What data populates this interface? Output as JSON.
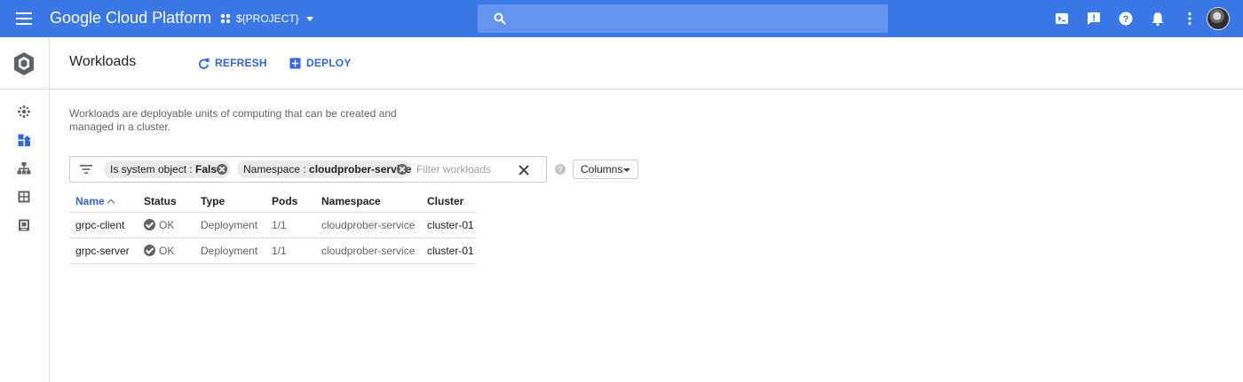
{
  "topbar": {
    "title": "Google Cloud Platform",
    "project": "${PROJECT}",
    "search_placeholder": "",
    "icons": [
      "menu-icon",
      "project-icon",
      "search-icon",
      "cloud-shell-icon",
      "feedback-icon",
      "help-icon",
      "notifications-icon",
      "more-vert-icon",
      "account-avatar"
    ],
    "color": "#3b78e7"
  },
  "leftnav": {
    "items": [
      "kubernetes-engine-logo",
      "clusters-icon",
      "workloads-icon",
      "services-icon",
      "applications-icon",
      "configuration-icon"
    ]
  },
  "header": {
    "title": "Workloads",
    "refresh_label": "REFRESH",
    "deploy_label": "DEPLOY",
    "accent": "#3367d6"
  },
  "description": "Workloads are deployable units of computing that can be created and managed in a cluster.",
  "filter": {
    "chips": [
      {
        "key": "Is system object",
        "value": "False"
      },
      {
        "key": "Namespace",
        "value": "cloudprober-service"
      }
    ],
    "placeholder": "Filter workloads",
    "columns_label": "Columns"
  },
  "table": {
    "columns": [
      "Name",
      "Status",
      "Type",
      "Pods",
      "Namespace",
      "Cluster"
    ],
    "sorted_column": "Name",
    "rows": [
      {
        "name": "grpc-client",
        "status": "OK",
        "type": "Deployment",
        "pods": "1/1",
        "namespace": "cloudprober-service",
        "cluster": "cluster-01"
      },
      {
        "name": "grpc-server",
        "status": "OK",
        "type": "Deployment",
        "pods": "1/1",
        "namespace": "cloudprober-service",
        "cluster": "cluster-01"
      }
    ]
  }
}
